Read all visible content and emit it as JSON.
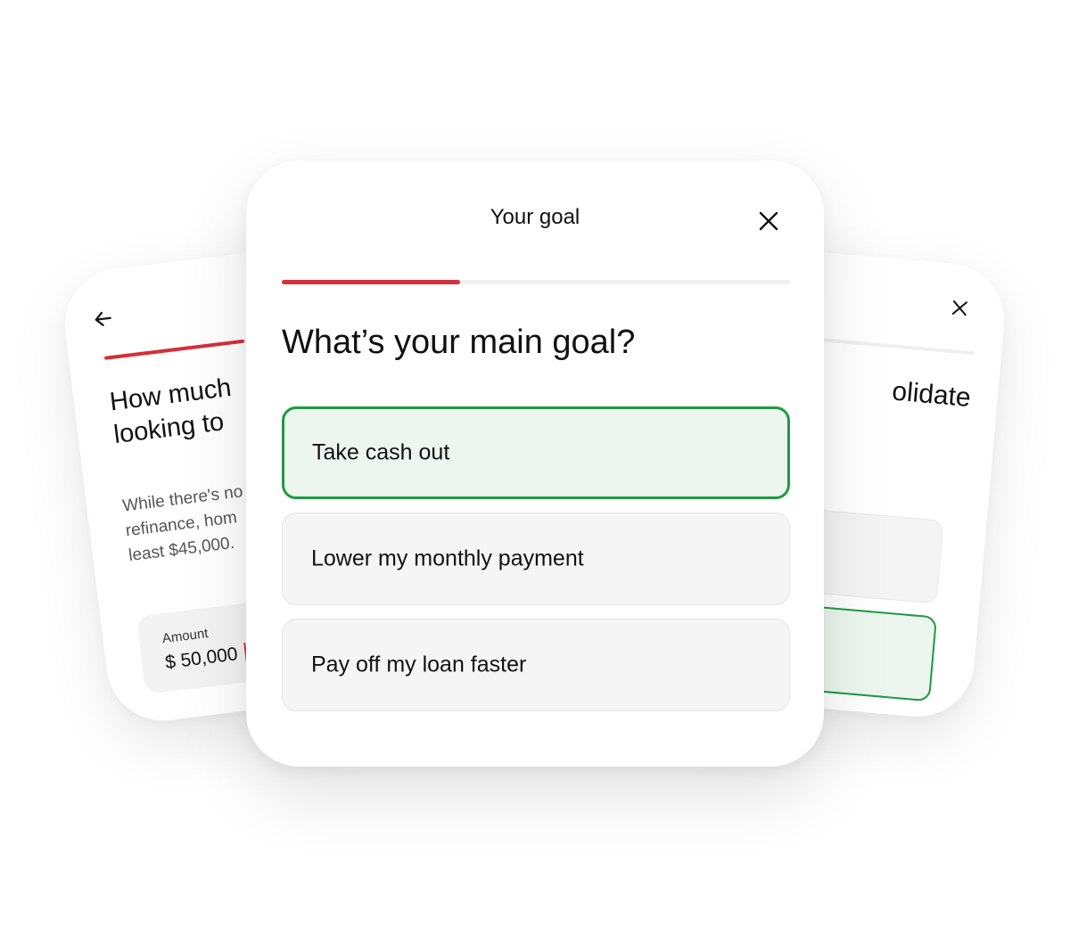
{
  "left_card": {
    "question": "How much\nlooking to",
    "description": "While there's no\nrefinance, hom\nleast $45,000.",
    "amount_label": "Amount",
    "amount_value": "$ 50,000",
    "progress": 0.45,
    "icons": {
      "back": "arrow-left-icon"
    }
  },
  "right_card": {
    "question": "olidate",
    "progress": 0.0,
    "icons": {
      "close": "close-icon"
    }
  },
  "main_card": {
    "title": "Your goal",
    "question": "What’s your main goal?",
    "progress": 0.35,
    "icons": {
      "close": "close-icon"
    },
    "options": [
      {
        "label": "Take cash out",
        "selected": true
      },
      {
        "label": "Lower my monthly payment",
        "selected": false
      },
      {
        "label": "Pay off my loan faster",
        "selected": false
      }
    ]
  },
  "colors": {
    "accent_red": "#d6303a",
    "selected_green": "#1e9a44",
    "selected_bg": "#ecf6ee",
    "option_bg": "#f5f5f5"
  }
}
